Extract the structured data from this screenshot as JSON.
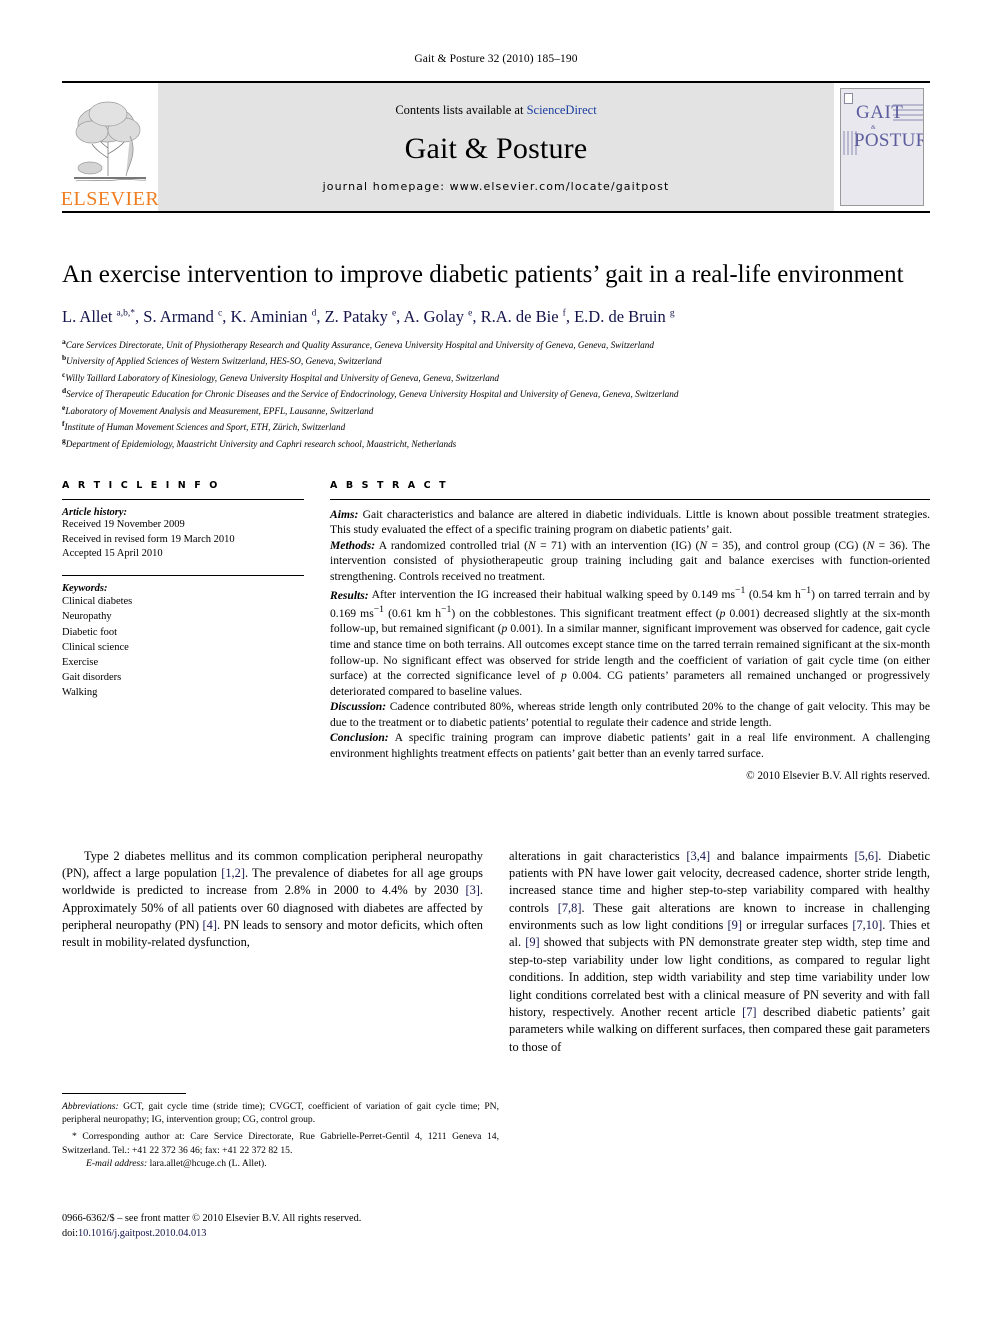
{
  "running_head": "Gait & Posture 32 (2010) 185–190",
  "masthead": {
    "contents_prefix": "Contents lists available at ",
    "contents_link": "ScienceDirect",
    "journal_name": "Gait & Posture",
    "homepage": "journal homepage: www.elsevier.com/locate/gaitpost",
    "publisher_name": "ELSEVIER",
    "cover_title_top": "GAIT",
    "cover_amp": "&",
    "cover_title_bottom": "POSTURE"
  },
  "article": {
    "title": "An exercise intervention to improve diabetic patients’ gait in a real-life environment",
    "authors_html": "L. Allet <sup>a,b,*</sup>, S. Armand <sup>c</sup>, K. Aminian <sup>d</sup>, Z. Pataky <sup>e</sup>, A. Golay <sup>e</sup>, R.A. de Bie <sup>f</sup>, E.D. de Bruin <sup>g</sup>",
    "affiliations": [
      {
        "mark": "a",
        "text": "Care Services Directorate, Unit of Physiotherapy Research and Quality Assurance, Geneva University Hospital and University of Geneva, Geneva, Switzerland"
      },
      {
        "mark": "b",
        "text": "University of Applied Sciences of Western Switzerland, HES-SO, Geneva, Switzerland"
      },
      {
        "mark": "c",
        "text": "Willy Taillard Laboratory of Kinesiology, Geneva University Hospital and University of Geneva, Geneva, Switzerland"
      },
      {
        "mark": "d",
        "text": "Service of Therapeutic Education for Chronic Diseases and the Service of Endocrinology, Geneva University Hospital and University of Geneva, Geneva, Switzerland"
      },
      {
        "mark": "e",
        "text": "Laboratory of Movement Analysis and Measurement, EPFL, Lausanne, Switzerland"
      },
      {
        "mark": "f",
        "text": "Institute of Human Movement Sciences and Sport, ETH, Zürich, Switzerland"
      },
      {
        "mark": "g",
        "text": "Department of Epidemiology, Maastricht University and Caphri research school, Maastricht, Netherlands"
      }
    ]
  },
  "article_info": {
    "heading": "A R T I C L E  I N F O",
    "history_label": "Article history:",
    "history": [
      "Received 19 November 2009",
      "Received in revised form 19 March 2010",
      "Accepted 15 April 2010"
    ],
    "keywords_label": "Keywords:",
    "keywords": [
      "Clinical diabetes",
      "Neuropathy",
      "Diabetic foot",
      "Clinical science",
      "Exercise",
      "Gait disorders",
      "Walking"
    ]
  },
  "abstract": {
    "heading": "A B S T R A C T",
    "sections": [
      {
        "label": "Aims:",
        "text": " Gait characteristics and balance are altered in diabetic individuals. Little is known about possible treatment strategies. This study evaluated the effect of a specific training program on diabetic patients’ gait."
      },
      {
        "label": "Methods:",
        "text": " A randomized controlled trial (N = 71) with an intervention (IG) (N = 35), and control group (CG) (N = 36). The intervention consisted of physiotherapeutic group training including gait and balance exercises with function-oriented strengthening. Controls received no treatment."
      },
      {
        "label": "Results:",
        "text": " After intervention the IG increased their habitual walking speed by 0.149 ms−1 (0.54 km h−1) on tarred terrain and by 0.169 ms−1 (0.61 km h−1) on the cobblestones. This significant treatment effect (p < 0.001) decreased slightly at the six-month follow-up, but remained significant (p < 0.001). In a similar manner, significant improvement was observed for cadence, gait cycle time and stance time on both terrains. All outcomes except stance time on the tarred terrain remained significant at the six-month follow-up. No significant effect was observed for stride length and the coefficient of variation of gait cycle time (on either surface) at the corrected significance level of p < 0.004. CG patients’ parameters all remained unchanged or progressively deteriorated compared to baseline values."
      },
      {
        "label": "Discussion:",
        "text": " Cadence contributed 80%, whereas stride length only contributed 20% to the change of gait velocity. This may be due to the treatment or to diabetic patients’ potential to regulate their cadence and stride length."
      },
      {
        "label": "Conclusion:",
        "text": " A specific training program can improve diabetic patients’ gait in a real life environment. A challenging environment highlights treatment effects on patients’ gait better than an evenly tarred surface."
      }
    ],
    "copyright": "© 2010 Elsevier B.V. All rights reserved."
  },
  "body": {
    "left_paragraph": "Type 2 diabetes mellitus and its common complication peripheral neuropathy (PN), affect a large population [1,2]. The prevalence of diabetes for all age groups worldwide is predicted to increase from 2.8% in 2000 to 4.4% by 2030 [3]. Approximately 50% of all patients over 60 diagnosed with diabetes are affected by peripheral neuropathy (PN) [4]. PN leads to sensory and motor deficits, which often result in mobility-related dysfunction,",
    "right_paragraph": "alterations in gait characteristics [3,4] and balance impairments [5,6]. Diabetic patients with PN have lower gait velocity, decreased cadence, shorter stride length, increased stance time and higher step-to-step variability compared with healthy controls [7,8]. These gait alterations are known to increase in challenging environments such as low light conditions [9] or irregular surfaces [7,10]. Thies et al. [9] showed that subjects with PN demonstrate greater step width, step time and step-to-step variability under low light conditions, as compared to regular light conditions. In addition, step width variability and step time variability under low light conditions correlated best with a clinical measure of PN severity and with fall history, respectively. Another recent article [7] described diabetic patients’ gait parameters while walking on different surfaces, then compared these gait parameters to those of"
  },
  "footnotes": {
    "abbreviations_label": "Abbreviations:",
    "abbreviations_text": " GCT, gait cycle time (stride time); CVGCT, coefficient of variation of gait cycle time; PN, peripheral neuropathy; IG, intervention group; CG, control group.",
    "corresponding": "* Corresponding author at: Care Service Directorate, Rue Gabrielle-Perret-Gentil 4, 1211 Geneva 14, Switzerland. Tel.: +41 22 372 36 46; fax: +41 22 372 82 15.",
    "email_label": "E-mail address:",
    "email": "lara.allet@hcuge.ch",
    "email_suffix": " (L. Allet).",
    "issn_line": "0966-6362/$ – see front matter © 2010 Elsevier B.V. All rights reserved.",
    "doi_label": "doi:",
    "doi": "10.1016/j.gaitpost.2010.04.013"
  }
}
